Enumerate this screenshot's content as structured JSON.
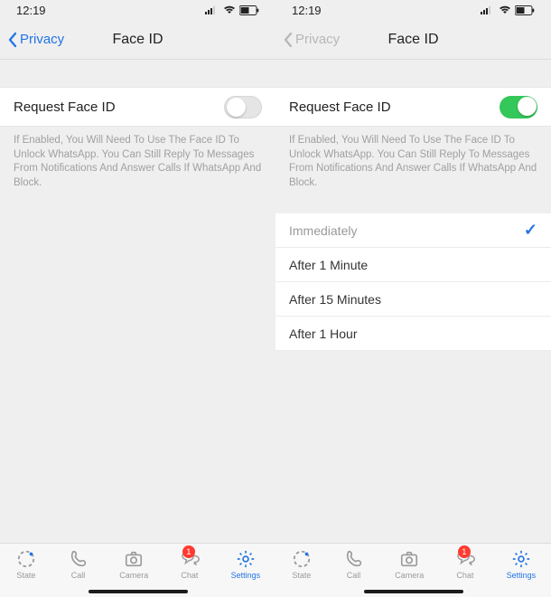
{
  "statusbar": {
    "time": "12:19"
  },
  "nav": {
    "back_label": "Privacy",
    "title": "Face ID"
  },
  "request_row": {
    "label": "Request Face ID"
  },
  "footnote": "If Enabled, You Will Need To Use The Face ID To Unlock WhatsApp. You Can Still Reply To Messages From Notifications And Answer Calls If WhatsApp And Block.",
  "left": {
    "toggle_on": false
  },
  "right": {
    "toggle_on": true
  },
  "options": {
    "immediately": "Immediately",
    "after1min": "After 1 Minute",
    "after15min": "After 15 Minutes",
    "after1hour": "After 1 Hour"
  },
  "tabs": {
    "state": "State",
    "call": "Call",
    "camera": "Camera",
    "chat": "Chat",
    "settings": "Settings",
    "chat_badge": "1"
  }
}
